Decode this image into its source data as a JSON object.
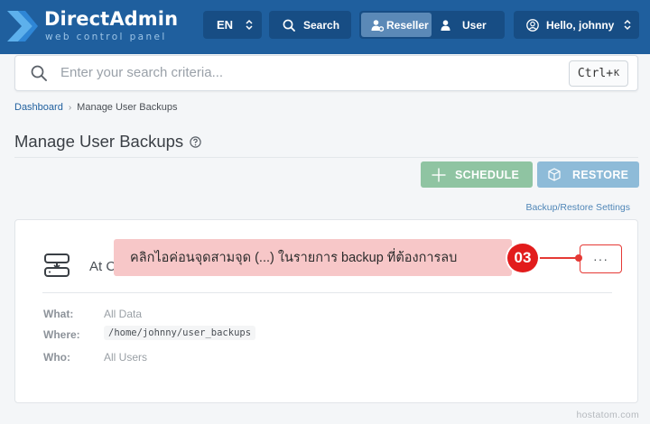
{
  "brand": {
    "title": "DirectAdmin",
    "subtitle": "web control panel",
    "accent": "#1f5f9e"
  },
  "topbar": {
    "language": "EN",
    "search_label": "Search",
    "roles": [
      {
        "label": "Reseller",
        "active": true,
        "icon": "user-gear-icon"
      },
      {
        "label": "User",
        "active": false,
        "icon": "user-icon"
      }
    ],
    "user_greeting": "Hello, johnny"
  },
  "search": {
    "placeholder": "Enter your search criteria...",
    "shortcut_main": "Ctrl+",
    "shortcut_key": "K"
  },
  "breadcrumb": {
    "items": [
      "Dashboard",
      "Manage User Backups"
    ]
  },
  "page": {
    "title": "Manage User Backups"
  },
  "actions": {
    "schedule_label": "SCHEDULE",
    "restore_label": "RESTORE",
    "settings_link": "Backup/Restore Settings"
  },
  "backup_card": {
    "title": "At C",
    "more_label": "···",
    "details": [
      {
        "label": "What:",
        "value": "All Data"
      },
      {
        "label": "Where:",
        "value": "/home/johnny/user_backups"
      },
      {
        "label": "Who:",
        "value": "All Users"
      }
    ]
  },
  "tutorial": {
    "instruction": "คลิกไอค่อนจุดสามจุด (...) ในรายการ backup ที่ต้องการลบ",
    "step": "03",
    "highlight_color": "#e53935"
  },
  "watermark": "hostatom.com"
}
